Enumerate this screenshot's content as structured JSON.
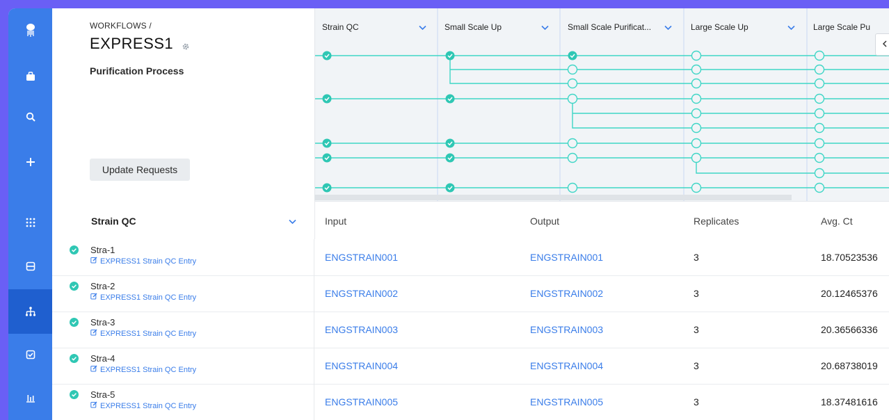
{
  "header": {
    "breadcrumb": "WORKFLOWS /",
    "title": "EXPRESS1",
    "subtitle": "Purification Process",
    "update_button": "Update Requests"
  },
  "nav": {
    "icons": [
      "logo-icon",
      "briefcase-icon",
      "search-icon",
      "plus-icon",
      "apps-grid-icon",
      "inventory-icon",
      "workflow-icon",
      "tasks-icon",
      "reports-icon"
    ],
    "active": "workflow-icon"
  },
  "stages": [
    {
      "label": "Strain QC"
    },
    {
      "label": "Small Scale Up"
    },
    {
      "label": "Small Scale Purificat..."
    },
    {
      "label": "Large Scale Up"
    },
    {
      "label": "Large Scale Pu"
    }
  ],
  "section": {
    "title": "Strain QC"
  },
  "table": {
    "columns": [
      "Input",
      "Output",
      "Replicates",
      "Avg. Ct"
    ],
    "rows": [
      {
        "name": "Stra-1",
        "link": "EXPRESS1 Strain QC Entry",
        "input": "ENGSTRAIN001",
        "output": "ENGSTRAIN001",
        "replicates": "3",
        "avg": "18.70523536"
      },
      {
        "name": "Stra-2",
        "link": "EXPRESS1 Strain QC Entry",
        "input": "ENGSTRAIN002",
        "output": "ENGSTRAIN002",
        "replicates": "3",
        "avg": "20.12465376"
      },
      {
        "name": "Stra-3",
        "link": "EXPRESS1 Strain QC Entry",
        "input": "ENGSTRAIN003",
        "output": "ENGSTRAIN003",
        "replicates": "3",
        "avg": "20.36566336"
      },
      {
        "name": "Stra-4",
        "link": "EXPRESS1 Strain QC Entry",
        "input": "ENGSTRAIN004",
        "output": "ENGSTRAIN004",
        "replicates": "3",
        "avg": "20.68738019"
      },
      {
        "name": "Stra-5",
        "link": "EXPRESS1 Strain QC Entry",
        "input": "ENGSTRAIN005",
        "output": "ENGSTRAIN005",
        "replicates": "3",
        "avg": "18.37481616"
      }
    ]
  },
  "colors": {
    "accent": "#3a7de9",
    "rail": "#3a7de9",
    "rail_active": "#1f5fcf",
    "teal": "#3fd6c6",
    "check": "#2fc7b4",
    "background": "#6a5ff5"
  }
}
